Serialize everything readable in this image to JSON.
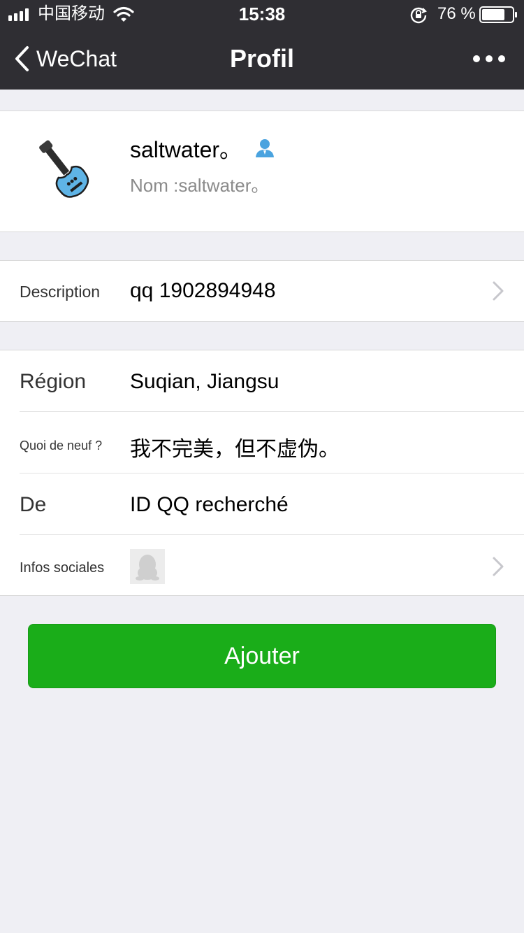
{
  "status_bar": {
    "carrier": "中国移动",
    "time": "15:38",
    "battery_pct": "76 %",
    "battery_level": 0.76
  },
  "nav": {
    "back_label": "WeChat",
    "title": "Profil"
  },
  "profile": {
    "name": "saltwater。",
    "nickname": "Nom :saltwater。"
  },
  "description": {
    "label": "Description",
    "value": "qq 1902894948"
  },
  "info": {
    "region_label": "Région",
    "region_value": "Suqian, Jiangsu",
    "whats_up_label": "Quoi de neuf ?",
    "whats_up_value": "我不完美，但不虚伪。",
    "from_label": "De",
    "from_value": "ID QQ recherché",
    "social_label": "Infos sociales"
  },
  "actions": {
    "add_label": "Ajouter"
  },
  "colors": {
    "nav_bg": "#2f2e33",
    "page_bg": "#efeff4",
    "accent_green": "#1aad19",
    "contact_icon_blue": "#4aa3df"
  }
}
